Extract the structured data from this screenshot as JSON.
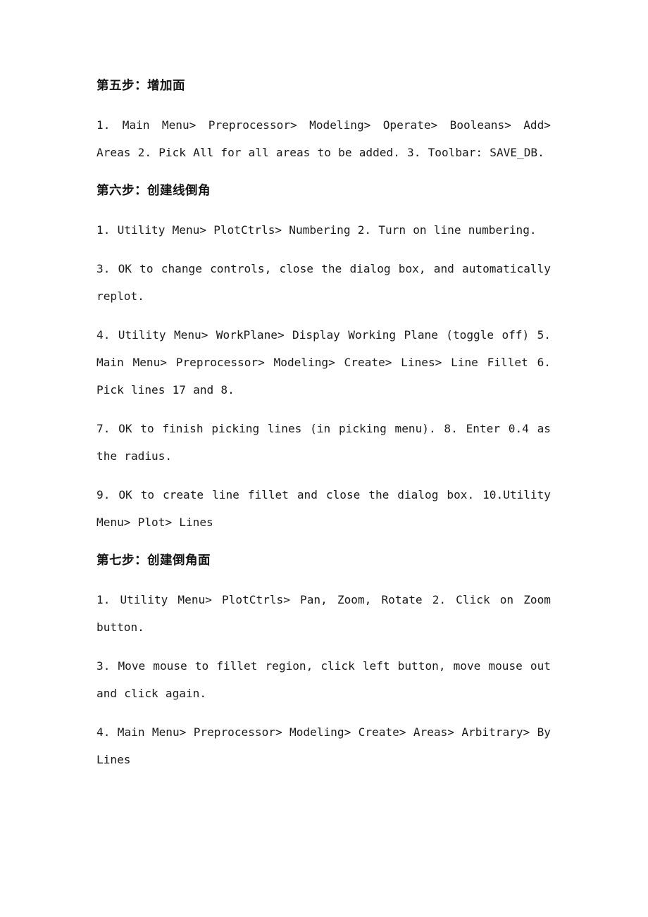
{
  "document": {
    "kind": "text-document",
    "page_background": "#ffffff",
    "text_color": "#1a1a1a",
    "text_align": "justify",
    "sections": [
      {
        "heading": "第五步：增加面",
        "paragraphs": [
          {
            "text": "1. Main Menu> Preprocessor> Modeling> Operate> Booleans> Add> Areas 2. Pick All for all areas to be added.  3. Toolbar: SAVE_DB.",
            "justify": true
          }
        ]
      },
      {
        "heading": "第六步：创建线倒角",
        "paragraphs": [
          {
            "text": "1. Utility Menu> PlotCtrls> Numbering 2. Turn on line numbering.",
            "justify": true
          },
          {
            "text": "3. OK to change controls, close the dialog box, and automatically replot.",
            "justify": true
          },
          {
            "text": "4. Utility Menu> WorkPlane> Display Working Plane (toggle off) 5. Main Menu> Preprocessor> Modeling> Create> Lines> Line Fillet 6. Pick lines 17 and 8.",
            "justify": true
          },
          {
            "text": "7. OK to finish picking lines (in picking menu). 8. Enter 0.4 as the radius.",
            "justify": true
          },
          {
            "text": "9. OK to create line fillet and close the dialog box. 10.Utility Menu> Plot> Lines",
            "justify": true
          }
        ]
      },
      {
        "heading": "第七步：创建倒角面",
        "paragraphs": [
          {
            "text": "1. Utility Menu> PlotCtrls> Pan, Zoom, Rotate 2. Click on Zoom button.",
            "justify": true
          },
          {
            "text": "3. Move mouse to fillet region, click left button, move mouse out and click again.",
            "justify": true
          },
          {
            "text": "4. Main Menu> Preprocessor> Modeling> Create> Areas> Arbitrary> By Lines",
            "justify": true
          }
        ]
      }
    ]
  }
}
